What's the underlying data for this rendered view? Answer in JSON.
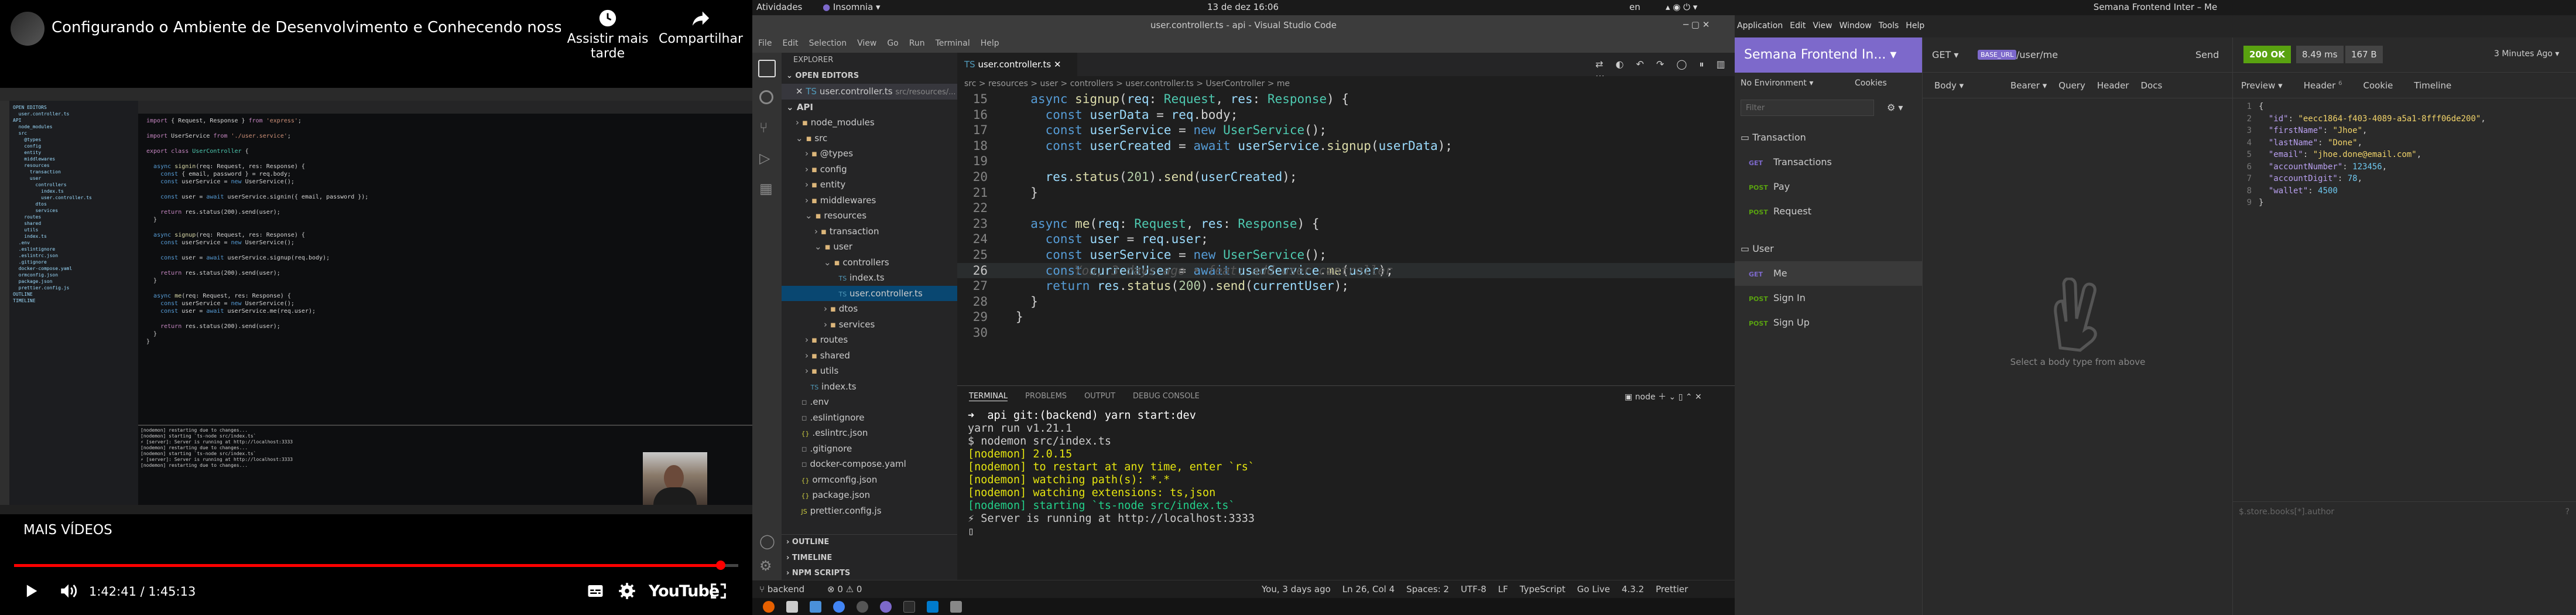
{
  "youtube": {
    "title": "Configurando o Ambiente de Desenvolvimento e Conhecendo nosso B...",
    "watch_later": "Assistir mais tarde",
    "share": "Compartilhar",
    "more_videos": "MAIS VÍDEOS",
    "time": "1:42:41 / 1:45:13",
    "progress_fraction": 0.976,
    "logo": "YouTube"
  },
  "gnome": {
    "activities": "Atividades",
    "app": "Insomnia",
    "clock": "13 de dez  16:06",
    "lang": "en"
  },
  "vscode": {
    "window_title": "user.controller.ts - api - Visual Studio Code",
    "menu": [
      "File",
      "Edit",
      "Selection",
      "View",
      "Go",
      "Run",
      "Terminal",
      "Help"
    ],
    "explorer_label": "EXPLORER",
    "open_editors_label": "OPEN EDITORS",
    "open_editor_file": "user.controller.ts",
    "open_editor_path": "src/resources/...",
    "tree": [
      {
        "label": "API",
        "depth": 0,
        "kind": "root"
      },
      {
        "label": "node_modules",
        "depth": 1,
        "kind": "folder"
      },
      {
        "label": "src",
        "depth": 1,
        "kind": "folder-open"
      },
      {
        "label": "@types",
        "depth": 2,
        "kind": "folder"
      },
      {
        "label": "config",
        "depth": 2,
        "kind": "folder"
      },
      {
        "label": "entity",
        "depth": 2,
        "kind": "folder"
      },
      {
        "label": "middlewares",
        "depth": 2,
        "kind": "folder"
      },
      {
        "label": "resources",
        "depth": 2,
        "kind": "folder-open"
      },
      {
        "label": "transaction",
        "depth": 3,
        "kind": "folder"
      },
      {
        "label": "user",
        "depth": 3,
        "kind": "folder-open"
      },
      {
        "label": "controllers",
        "depth": 4,
        "kind": "folder-open"
      },
      {
        "label": "index.ts",
        "depth": 5,
        "kind": "ts"
      },
      {
        "label": "user.controller.ts",
        "depth": 5,
        "kind": "ts",
        "active": true
      },
      {
        "label": "dtos",
        "depth": 4,
        "kind": "folder"
      },
      {
        "label": "services",
        "depth": 4,
        "kind": "folder"
      },
      {
        "label": "routes",
        "depth": 2,
        "kind": "folder"
      },
      {
        "label": "shared",
        "depth": 2,
        "kind": "folder"
      },
      {
        "label": "utils",
        "depth": 2,
        "kind": "folder"
      },
      {
        "label": "index.ts",
        "depth": 2,
        "kind": "ts"
      },
      {
        "label": ".env",
        "depth": 1,
        "kind": "file"
      },
      {
        "label": ".eslintignore",
        "depth": 1,
        "kind": "file"
      },
      {
        "label": ".eslintrc.json",
        "depth": 1,
        "kind": "json"
      },
      {
        "label": ".gitignore",
        "depth": 1,
        "kind": "file"
      },
      {
        "label": "docker-compose.yaml",
        "depth": 1,
        "kind": "file"
      },
      {
        "label": "ormconfig.json",
        "depth": 1,
        "kind": "json"
      },
      {
        "label": "package.json",
        "depth": 1,
        "kind": "json"
      },
      {
        "label": "prettier.config.js",
        "depth": 1,
        "kind": "js"
      }
    ],
    "outline_label": "OUTLINE",
    "timeline_label": "TIMELINE",
    "npm_label": "NPM SCRIPTS",
    "tab_file": "user.controller.ts",
    "breadcrumb": "src > resources > user > controllers > user.controller.ts > UserController > me",
    "code": [
      {
        "n": "15",
        "t": "  async signup(req: Request, res: Response) {"
      },
      {
        "n": "16",
        "t": "    const userData = req.body;"
      },
      {
        "n": "17",
        "t": "    const userService = new UserService();"
      },
      {
        "n": "18",
        "t": "    const userCreated = await userService.signup(userData);"
      },
      {
        "n": "19",
        "t": ""
      },
      {
        "n": "20",
        "t": "    res.status(201).send(userCreated);"
      },
      {
        "n": "21",
        "t": "  }"
      },
      {
        "n": "22",
        "t": ""
      },
      {
        "n": "23",
        "t": "  async me(req: Request, res: Response) {"
      },
      {
        "n": "24",
        "t": "    const user = req.user;"
      },
      {
        "n": "25",
        "t": "    const userService = new UserService();"
      },
      {
        "n": "26",
        "t": "    const currentUser = await userService.me(user);"
      },
      {
        "n": "27",
        "t": "    return res.status(200).send(currentUser);"
      },
      {
        "n": "28",
        "t": "  }"
      },
      {
        "n": "29",
        "t": "}"
      },
      {
        "n": "30",
        "t": ""
      }
    ],
    "blame": "You, 3 days ago • feat: add user controller",
    "term_tabs": [
      "TERMINAL",
      "PROBLEMS",
      "OUTPUT",
      "DEBUG CONSOLE"
    ],
    "term_select": "node",
    "terminal": [
      "➜  api git:(backend) yarn start:dev",
      "yarn run v1.21.1",
      "$ nodemon src/index.ts",
      "[nodemon] 2.0.15",
      "[nodemon] to restart at any time, enter `rs`",
      "[nodemon] watching path(s): *.*",
      "[nodemon] watching extensions: ts,json",
      "[nodemon] starting `ts-node src/index.ts`",
      "⚡ Server is running at http://localhost:3333",
      "▯"
    ],
    "status_left": [
      "backend",
      "⊗ 0 ⚠ 0"
    ],
    "status_right": [
      "You, 3 days ago",
      "Ln 26, Col 4",
      "Spaces: 2",
      "UTF-8",
      "LF",
      "TypeScript",
      "Go Live",
      "4.3.2",
      "Prettier"
    ]
  },
  "insomnia": {
    "window_title": "Semana Frontend Inter – Me",
    "menu": [
      "Application",
      "Edit",
      "View",
      "Window",
      "Tools",
      "Help"
    ],
    "workspace": "Semana Frontend In...",
    "env": "No Environment",
    "cookies": "Cookies",
    "filter_placeholder": "Filter",
    "folders": [
      {
        "name": "Transaction",
        "items": [
          {
            "m": "GET",
            "n": "Transactions"
          },
          {
            "m": "POST",
            "n": "Pay"
          },
          {
            "m": "POST",
            "n": "Request"
          }
        ]
      },
      {
        "name": "User",
        "items": [
          {
            "m": "GET",
            "n": "Me",
            "active": true
          },
          {
            "m": "POST",
            "n": "Sign In"
          },
          {
            "m": "POST",
            "n": "Sign Up"
          }
        ]
      }
    ],
    "method": "GET",
    "url_var": "BASE_URL",
    "url_path": "/user/me",
    "send": "Send",
    "req_tabs": [
      "Body",
      "Bearer",
      "Query",
      "Header",
      "Docs"
    ],
    "body_hint": "Select a body type from above",
    "status": "200 OK",
    "time": "8.49 ms",
    "size": "167 B",
    "ago": "3 Minutes Ago",
    "resp_tabs": [
      "Preview",
      "Header",
      "Cookie",
      "Timeline"
    ],
    "header_count": "6",
    "json_lines": [
      "{",
      "  \"id\": \"eecc1864-f403-4089-a5a1-8fff06de200\",",
      "  \"firstName\": \"Jhoe\",",
      "  \"lastName\": \"Done\",",
      "  \"email\": \"jhoe.done@email.com\",",
      "  \"accountNumber\": 123456,",
      "  \"accountDigit\": 78,",
      "  \"wallet\": 4500",
      "}"
    ],
    "filter_hint": "$.store.books[*].author"
  }
}
